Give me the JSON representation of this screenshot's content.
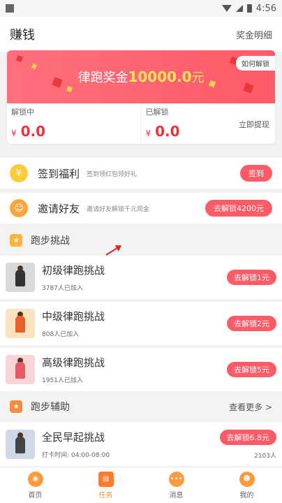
{
  "status_bar": {
    "time": "4:56"
  },
  "header": {
    "title": "赚钱",
    "bonus_detail": "奖金明细"
  },
  "banner": {
    "prefix": "律跑奖金",
    "amount": "10000.0",
    "unit": "元",
    "how_to_unlock": "如何解锁"
  },
  "stats": {
    "unlocking_label": "解锁中",
    "unlocking_value": "0.0",
    "unlocked_label": "已解锁",
    "unlocked_value": "0.0",
    "currency": "¥",
    "withdraw": "立即提现"
  },
  "tasks": [
    {
      "title": "签到福利",
      "subtitle": "签到领红包领好礼",
      "button": "签到",
      "icon": "coin-icon",
      "color": "#ffc93c"
    },
    {
      "title": "邀请好友",
      "subtitle": "邀请好友解锁千元现金",
      "button": "去解锁4200元",
      "icon": "friends-icon",
      "color": "#ffa53c"
    }
  ],
  "section_running": {
    "title": "跑步挑战"
  },
  "challenges": [
    {
      "name": "初级律跑挑战",
      "joined": "3787人已加入",
      "button": "去解锁1元",
      "thumb_bg": "#d9d9d9"
    },
    {
      "name": "中级律跑挑战",
      "joined": "808人已加入",
      "button": "去解锁2元",
      "thumb_bg": "#fbe3c0"
    },
    {
      "name": "高级律跑挑战",
      "joined": "1951人已加入",
      "button": "去解锁5元",
      "thumb_bg": "#f9d4d6"
    }
  ],
  "section_aux": {
    "title": "跑步辅助",
    "more": "查看更多 >"
  },
  "aux_challenge": {
    "name": "全民早起挑战",
    "time_label": "打卡时间: 04:00-08:00",
    "button": "去解锁6.8元",
    "count": "2103人"
  },
  "tabbar": [
    {
      "label": "首页",
      "icon": "planet-icon"
    },
    {
      "label": "任务",
      "icon": "task-icon",
      "active": true
    },
    {
      "label": "消息",
      "icon": "message-icon"
    },
    {
      "label": "我的",
      "icon": "profile-icon"
    }
  ],
  "colors": {
    "accent": "#ff5b66",
    "value_red": "#f0303a",
    "tab_active": "#ff8a2a"
  }
}
